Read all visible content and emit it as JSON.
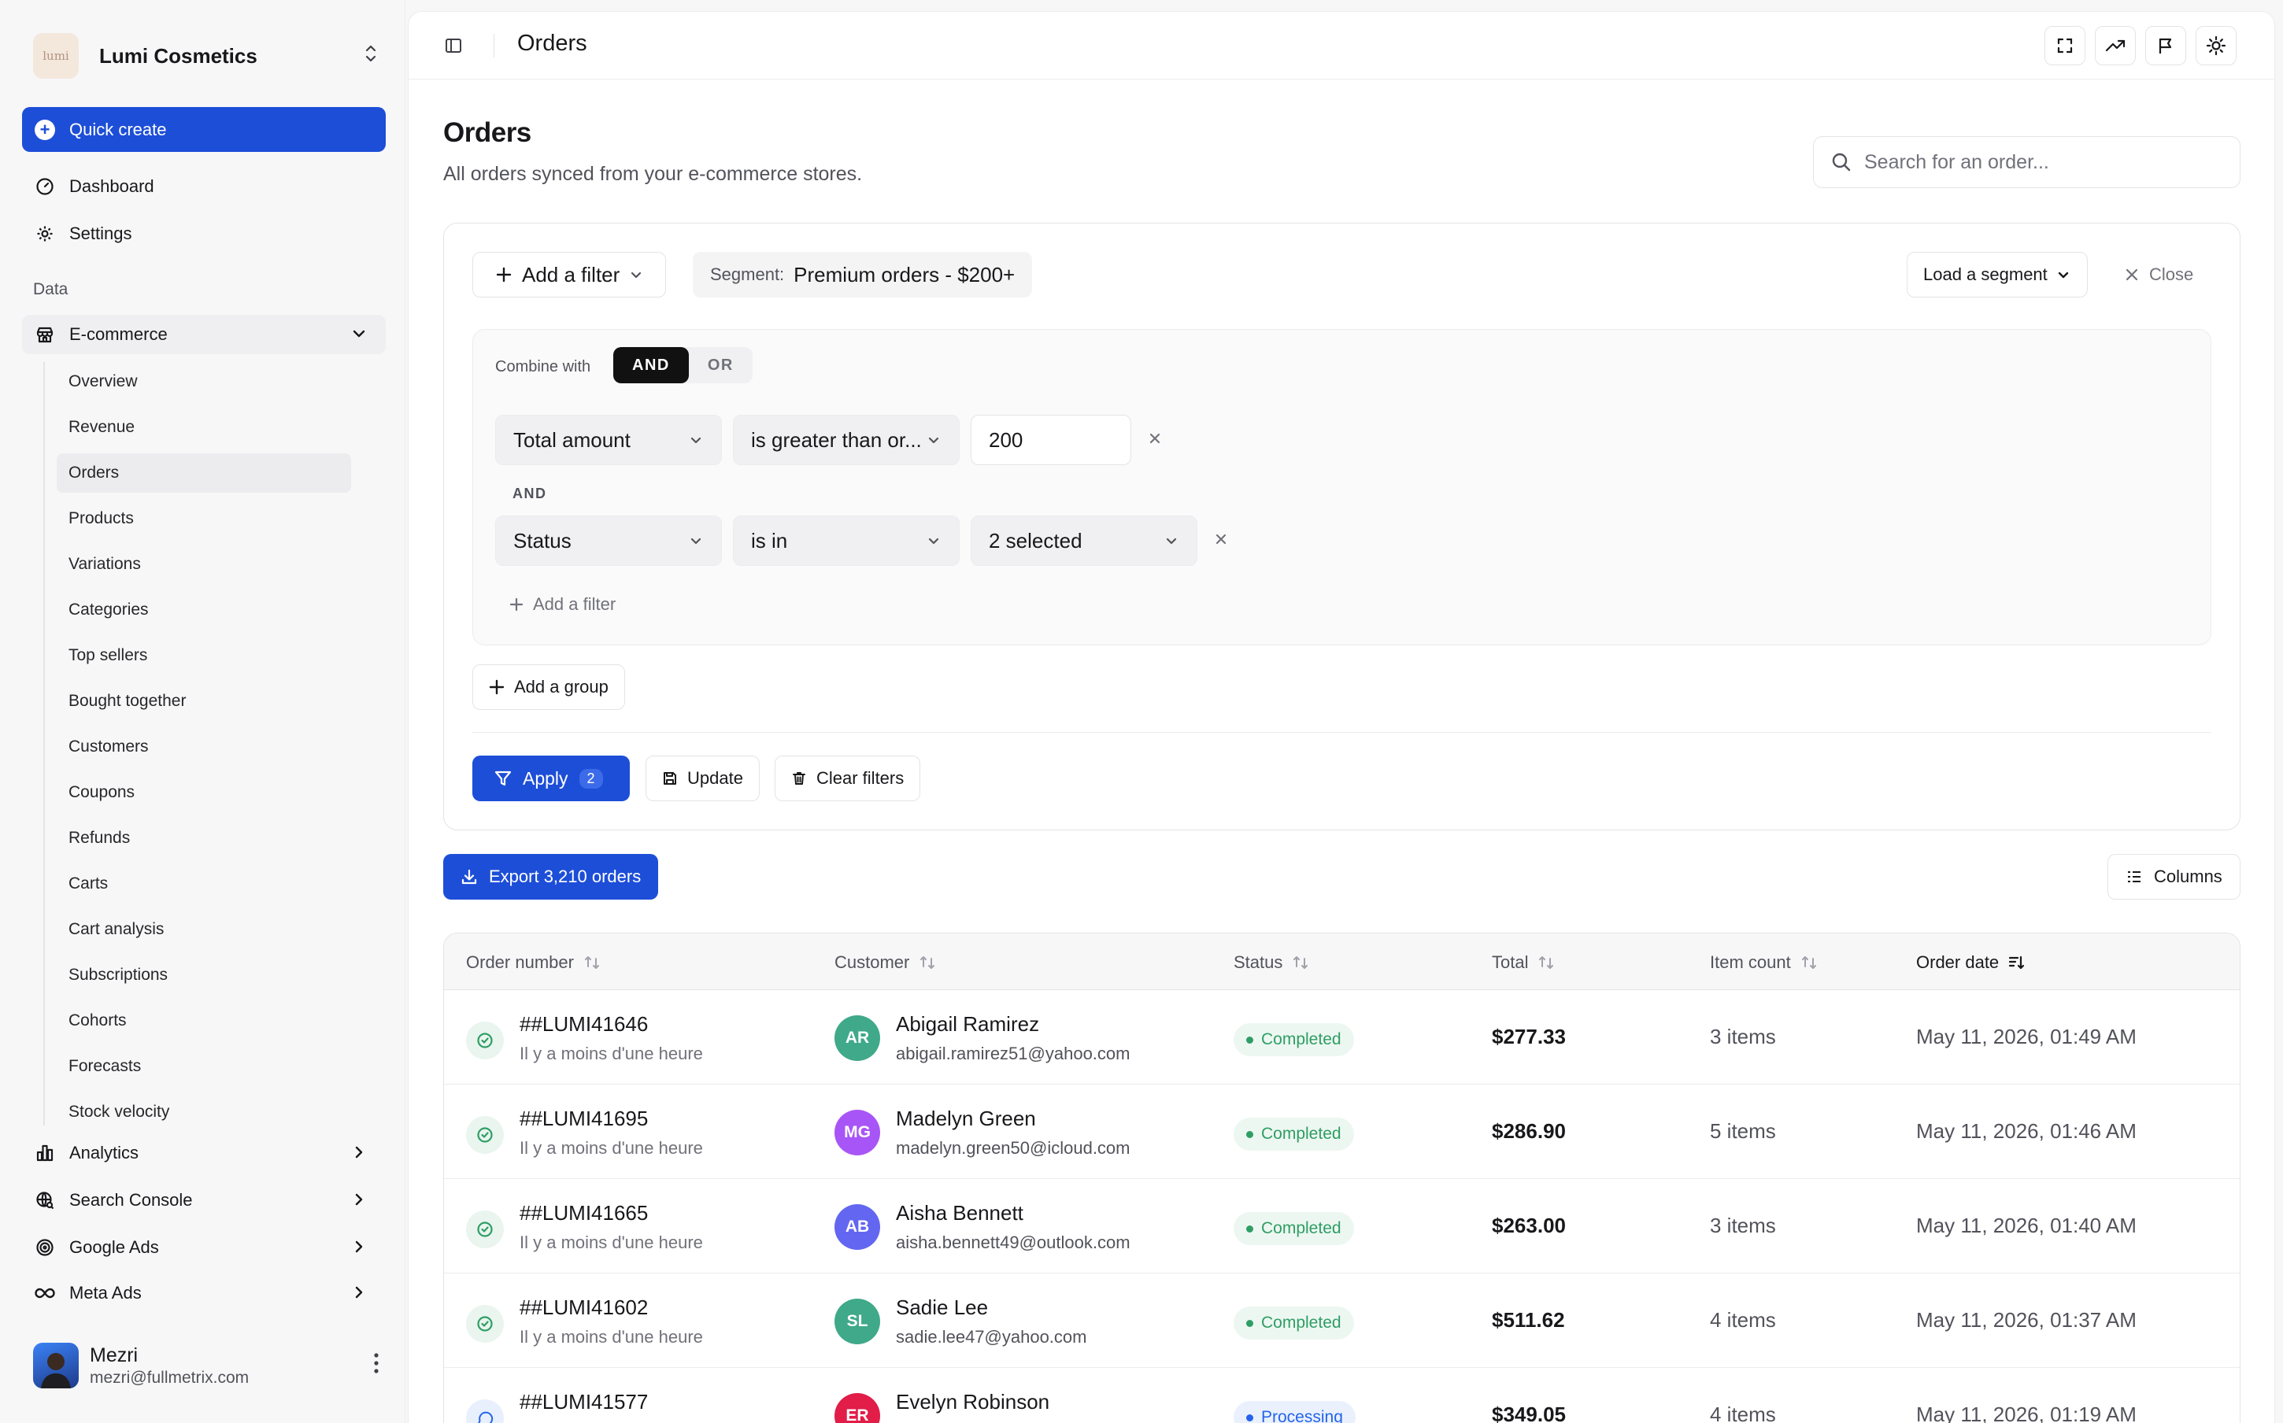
{
  "brand": {
    "name": "Lumi Cosmetics",
    "logo_text": "lumi"
  },
  "sidebar": {
    "quick_create": "Quick create",
    "dashboard": "Dashboard",
    "settings": "Settings",
    "section_data": "Data",
    "ecommerce": "E-commerce",
    "ecommerce_items": [
      "Overview",
      "Revenue",
      "Orders",
      "Products",
      "Variations",
      "Categories",
      "Top sellers",
      "Bought together",
      "Customers",
      "Coupons",
      "Refunds",
      "Carts",
      "Cart analysis",
      "Subscriptions",
      "Cohorts",
      "Forecasts",
      "Stock velocity"
    ],
    "active_item": "Orders",
    "analytics": "Analytics",
    "search_console": "Search Console",
    "google_ads": "Google Ads",
    "meta_ads": "Meta Ads"
  },
  "user": {
    "name": "Mezri",
    "email": "mezri@fullmetrix.com"
  },
  "topbar": {
    "title": "Orders"
  },
  "page": {
    "title": "Orders",
    "subtitle": "All orders synced from your e-commerce stores."
  },
  "search": {
    "placeholder": "Search for an order..."
  },
  "filters": {
    "add_filter": "Add a filter",
    "segment_label": "Segment:",
    "segment_value": "Premium orders - $200+",
    "load_segment": "Load a segment",
    "close": "Close",
    "combine_with": "Combine with",
    "and": "AND",
    "or": "OR",
    "row_and": "AND",
    "rule1": {
      "field": "Total amount",
      "operator": "is greater than or...",
      "value": "200"
    },
    "rule2": {
      "field": "Status",
      "operator": "is in",
      "value": "2 selected"
    },
    "add_filter_inline": "Add a filter",
    "add_group": "Add a group",
    "apply": "Apply",
    "apply_count": "2",
    "update": "Update",
    "clear": "Clear filters"
  },
  "actions": {
    "export": "Export 3,210 orders",
    "columns": "Columns"
  },
  "table": {
    "headers": {
      "order": "Order number",
      "customer": "Customer",
      "status": "Status",
      "total": "Total",
      "items": "Item count",
      "date": "Order date"
    },
    "rows": [
      {
        "order": "##LUMI41646",
        "sub": "Il y a moins d'une heure",
        "initials": "AR",
        "color": "#3fa98a",
        "name": "Abigail Ramirez",
        "email": "abigail.ramirez51@yahoo.com",
        "status": "Completed",
        "total": "$277.33",
        "items": "3 items",
        "date": "May 11, 2026, 01:49 AM"
      },
      {
        "order": "##LUMI41695",
        "sub": "Il y a moins d'une heure",
        "initials": "MG",
        "color": "#a855f7",
        "name": "Madelyn Green",
        "email": "madelyn.green50@icloud.com",
        "status": "Completed",
        "total": "$286.90",
        "items": "5 items",
        "date": "May 11, 2026, 01:46 AM"
      },
      {
        "order": "##LUMI41665",
        "sub": "Il y a moins d'une heure",
        "initials": "AB",
        "color": "#6366f1",
        "name": "Aisha Bennett",
        "email": "aisha.bennett49@outlook.com",
        "status": "Completed",
        "total": "$263.00",
        "items": "3 items",
        "date": "May 11, 2026, 01:40 AM"
      },
      {
        "order": "##LUMI41602",
        "sub": "Il y a moins d'une heure",
        "initials": "SL",
        "color": "#3fa98a",
        "name": "Sadie Lee",
        "email": "sadie.lee47@yahoo.com",
        "status": "Completed",
        "total": "$511.62",
        "items": "4 items",
        "date": "May 11, 2026, 01:37 AM"
      },
      {
        "order": "##LUMI41577",
        "sub": "",
        "initials": "ER",
        "color": "#e11d48",
        "name": "Evelyn Robinson",
        "email": "",
        "status": "Processing",
        "total": "$349.05",
        "items": "4 items",
        "date": "May 11, 2026, 01:19 AM"
      }
    ]
  }
}
